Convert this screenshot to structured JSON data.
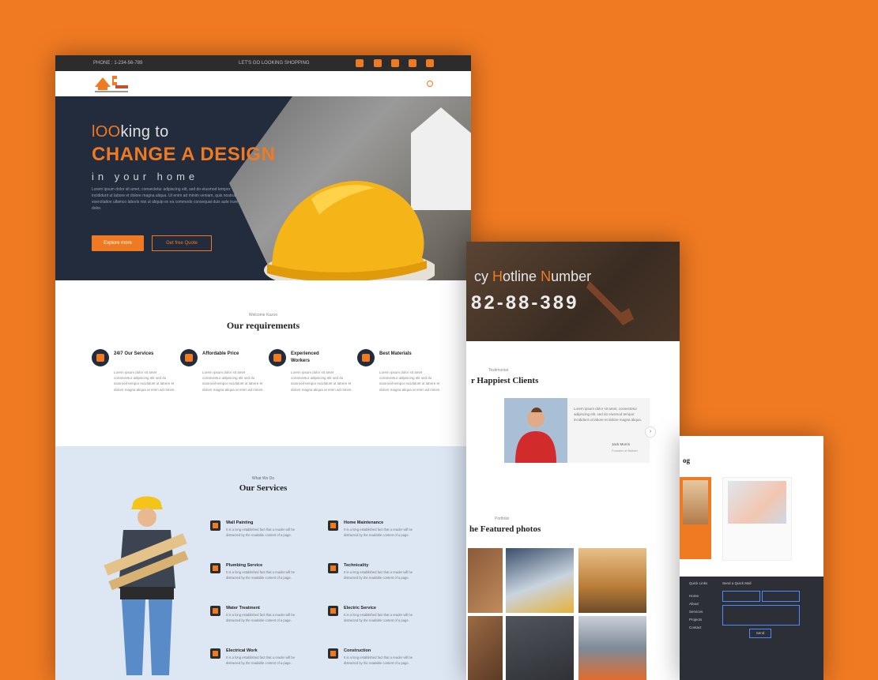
{
  "colors": {
    "background": "#f07a22",
    "accent": "#f07a22",
    "dark": "#232c3c",
    "topbar": "#2c2c2c"
  },
  "main": {
    "topbar": {
      "phone": "PHONE : 1-234-56-789",
      "center": "LET'S GO LOOKING SHOPPING",
      "social_icons": [
        "facebook-icon",
        "twitter-icon",
        "google-plus-icon",
        "linkedin-icon",
        "rss-icon"
      ]
    },
    "hero": {
      "line1_accent": "lOO",
      "line1_rest": "king to",
      "line2": "CHANGE A DESIGN",
      "line3": "in your home",
      "body": "Lorem ipsum dolor sit amet, consectetur adipiscing elit, sed do eiusmod tempor incididunt ut labore et dolore magna aliqua. Ut enim ad minim veniam, quis nostrud exercitation ullamco laboris nisi ut aliquip ex ea commodo consequat duis aute irure dolor.",
      "primary_button": "Explore more",
      "secondary_button": "Get free Quote"
    },
    "requirements": {
      "subtitle": "Welcome Kazoo",
      "title": "Our requirements",
      "items": [
        {
          "title": "24/7 Our Services",
          "text": "Lorem ipsum dolor sit amet consectetur adipiscing elit sed do eiusmod tempor incididunt ut labore et dolore magna aliqua ut enim ad minim."
        },
        {
          "title": "Affordable Price",
          "text": "Lorem ipsum dolor sit amet consectetur adipiscing elit sed do eiusmod tempor incididunt ut labore et dolore magna aliqua ut enim ad minim."
        },
        {
          "title": "Experienced Workers",
          "text": "Lorem ipsum dolor sit amet consectetur adipiscing elit sed do eiusmod tempor incididunt ut labore et dolore magna aliqua ut enim ad minim."
        },
        {
          "title": "Best Materials",
          "text": "Lorem ipsum dolor sit amet consectetur adipiscing elit sed do eiusmod tempor incididunt ut labore et dolore magna aliqua ut enim ad minim."
        }
      ]
    },
    "services": {
      "subtitle": "What We Do",
      "title": "Our Services",
      "items": [
        {
          "title": "Wall Painting",
          "text": "It is a long established fact that a reader will be distracted by the readable content of a page."
        },
        {
          "title": "Home Maintenance",
          "text": "It is a long established fact that a reader will be distracted by the readable content of a page."
        },
        {
          "title": "Plumbing Service",
          "text": "It is a long established fact that a reader will be distracted by the readable content of a page."
        },
        {
          "title": "Technicality",
          "text": "It is a long established fact that a reader will be distracted by the readable content of a page."
        },
        {
          "title": "Water Treatment",
          "text": "It is a long established fact that a reader will be distracted by the readable content of a page."
        },
        {
          "title": "Electric Service",
          "text": "It is a long established fact that a reader will be distracted by the readable content of a page."
        },
        {
          "title": "Electrical Work",
          "text": "It is a long established fact that a reader will be distracted by the readable content of a page."
        },
        {
          "title": "Construction",
          "text": "It is a long established fact that a reader will be distracted by the readable content of a page."
        }
      ]
    }
  },
  "second": {
    "hotline_prefix": "cy ",
    "hotline_h": "H",
    "hotline_mid": "otline ",
    "hotline_n": "N",
    "hotline_end": "umber",
    "number": "82-88-389",
    "clients_subtitle": "Testimonial",
    "clients_title": "r Happiest Clients",
    "testimonial_text": "Lorem ipsum dolor sit amet, consectetur adipiscing elit, sed do eiusmod tempor incididunt ut labore et dolore magna aliqua.",
    "testimonial_name": "Jack Morris",
    "testimonial_role": "Founder of Builder",
    "next_arrow": "›",
    "projects_subtitle": "Portfolio",
    "projects_title": "he Featured photos"
  },
  "third": {
    "title": "og",
    "footer_left": "Quick Links",
    "footer_right": "Send a Quick Mail",
    "footer_links": [
      "Home",
      "About",
      "Services",
      "Projects",
      "Contact"
    ],
    "submit": "Send"
  }
}
